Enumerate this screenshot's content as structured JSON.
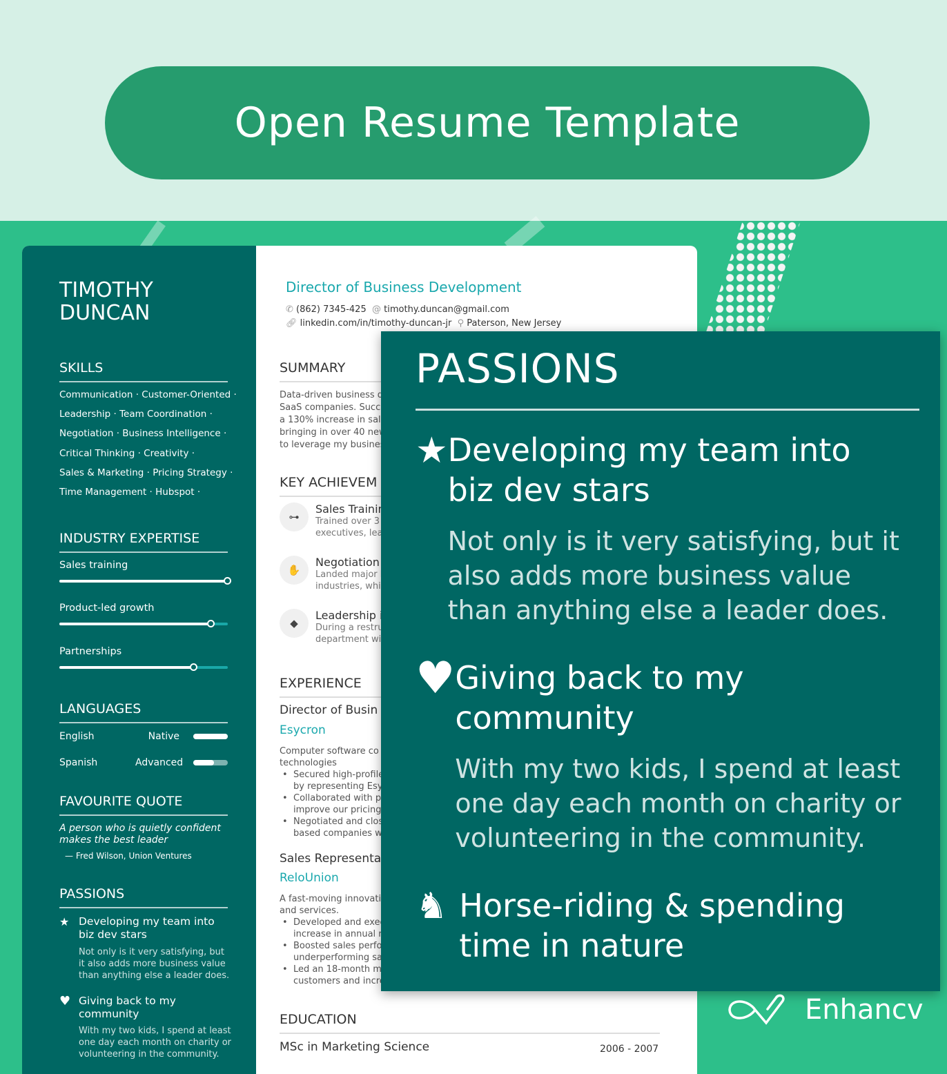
{
  "banner": {
    "title": "Open Resume Template"
  },
  "resume": {
    "name_line1": "TIMOTHY",
    "name_line2": "DUNCAN",
    "job_title": "Director of Business Development",
    "contact": {
      "phone": "(862) 7345-425",
      "email": "timothy.duncan@gmail.com",
      "linkedin": "linkedin.com/in/timothy-duncan-jr",
      "location": "Paterson, New Jersey"
    },
    "skills": {
      "heading": "SKILLS",
      "lines": [
        "Communication · Customer-Oriented ·",
        "Leadership · Team Coordination ·",
        "Negotiation · Business Intelligence ·",
        "Critical Thinking · Creativity ·",
        "Sales & Marketing · Pricing Strategy ·",
        "Time Management · Hubspot ·"
      ]
    },
    "expertise": {
      "heading": "INDUSTRY EXPERTISE",
      "items": [
        {
          "label": "Sales training",
          "level_percent": 100
        },
        {
          "label": "Product-led growth",
          "level_percent": 90
        },
        {
          "label": "Partnerships",
          "level_percent": 80
        }
      ]
    },
    "languages": {
      "heading": "LANGUAGES",
      "items": [
        {
          "name": "English",
          "level": "Native",
          "fill_percent": 100
        },
        {
          "name": "Spanish",
          "level": "Advanced",
          "fill_percent": 60
        }
      ]
    },
    "quote": {
      "heading": "FAVOURITE QUOTE",
      "text": "A person who is quietly confident makes the best leader",
      "author": "Fred Wilson, Union Ventures"
    },
    "passions": {
      "heading": "PASSIONS",
      "items": [
        {
          "icon": "star-icon",
          "title": "Developing my team into biz dev stars",
          "desc": "Not only is it very satisfying, but it also adds more business value than anything else a leader does."
        },
        {
          "icon": "heart-icon",
          "title": "Giving back to my community",
          "desc": "With my two kids, I spend at least one day each month on charity or volunteering in the community."
        },
        {
          "icon": "chess-knight-icon",
          "title": "Horse-riding & spending time in nature",
          "desc": ""
        }
      ]
    },
    "summary": {
      "heading": "SUMMARY",
      "lines": [
        "Data-driven business d",
        "SaaS companies. Succ",
        "a 130% increase in sale",
        "bringing in over 40 new",
        "to leverage my busines"
      ]
    },
    "achievements": {
      "heading": "KEY ACHIEVEM",
      "items": [
        {
          "icon": "dumbbell-icon",
          "title": "Sales Trainin",
          "l1": "Trained over 3",
          "l2": "executives, lea"
        },
        {
          "icon": "handshake-icon",
          "title": "Negotiation",
          "l1": "Landed major b",
          "l2": "industries, whi"
        },
        {
          "icon": "diamond-icon",
          "title": "Leadership i",
          "l1": "During a restru",
          "l2": "department wi"
        }
      ]
    },
    "experience": {
      "heading": "EXPERIENCE",
      "jobs": [
        {
          "role": "Director of Busin",
          "company": "Esycron",
          "desc": [
            "Computer software co",
            "technologies"
          ],
          "bullets": [
            [
              "Secured high-profile",
              "by representing Esy"
            ],
            [
              "Collaborated with p",
              "improve our pricing"
            ],
            [
              "Negotiated and clos",
              "based companies w"
            ]
          ]
        },
        {
          "role": "Sales Representa",
          "company": "ReloUnion",
          "desc": [
            "A fast-moving innovativ",
            "and services."
          ],
          "bullets": [
            [
              "Developed and exec",
              "increase in annual r"
            ],
            [
              "Boosted sales perfo",
              "underperforming sa"
            ],
            [
              "Led an 18-month ma",
              "customers and incre"
            ]
          ]
        }
      ]
    },
    "education": {
      "heading": "EDUCATION",
      "degree": "MSc in Marketing Science",
      "dates": "2006 - 2007"
    }
  },
  "brand": {
    "name": "Enhancv"
  },
  "colors": {
    "mint": "#d6f0e6",
    "pill": "#269c6e",
    "green": "#2dbf8a",
    "teal_dark": "#006763",
    "accent": "#1aa8ad"
  }
}
